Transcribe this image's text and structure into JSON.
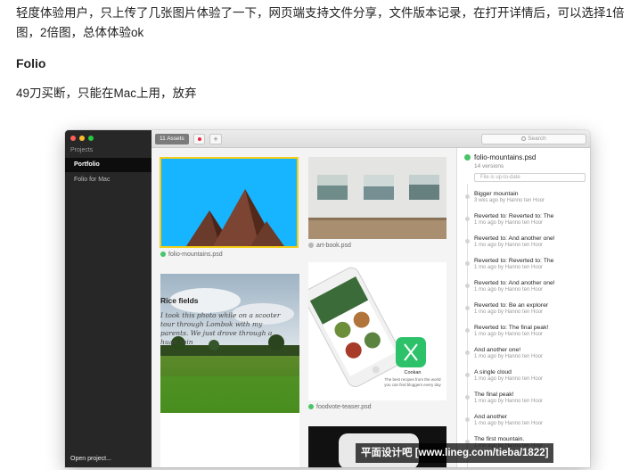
{
  "article": {
    "intro": "轻度体验用户，只上传了几张图片体验了一下，网页端支持文件分享，文件版本记录，在打开详情后，可以选择1倍图，2倍图，总体体验ok",
    "heading": "Folio",
    "verdict": "49刀买断，只能在Mac上用，放弃"
  },
  "app": {
    "sidebar": {
      "section_label": "Projects",
      "items": [
        {
          "label": "Portfolio",
          "selected": true
        },
        {
          "label": "Folio for Mac",
          "selected": false
        }
      ],
      "open_project_label": "Open project..."
    },
    "toolbar": {
      "assets_tab_label": "11 Assets",
      "add_label": "+",
      "search_placeholder": "Search"
    },
    "assets": [
      {
        "name": "folio-mountains.psd",
        "status": "green"
      },
      {
        "name": "art-book.psd",
        "status": "gray"
      },
      {
        "name": "foodvote-teaser.psd",
        "status": "green"
      }
    ],
    "rice_card": {
      "title": "Rice fields",
      "body": "I took this photo while on a scooter tour through Lombok with my parents. We just drove through a huge rain"
    },
    "versions": {
      "file_name": "folio-mountains.psd",
      "count_label": "14 versions",
      "status_text": "File is up-to-date",
      "entries": [
        {
          "title": "Bigger mountain",
          "meta": "3 wks ago by Hanno ten Hoor"
        },
        {
          "title": "Reverted to: Reverted to: The",
          "meta": "1 mo ago by Hanno ten Hoor"
        },
        {
          "title": "Reverted to: And another one!",
          "meta": "1 mo ago by Hanno ten Hoor"
        },
        {
          "title": "Reverted to: Reverted to: The",
          "meta": "1 mo ago by Hanno ten Hoor"
        },
        {
          "title": "Reverted to: And another one!",
          "meta": "1 mo ago by Hanno ten Hoor"
        },
        {
          "title": "Reverted to: Be an explorer",
          "meta": "1 mo ago by Hanno ten Hoor"
        },
        {
          "title": "Reverted to: The final peak!",
          "meta": "1 mo ago by Hanno ten Hoor"
        },
        {
          "title": "And another one!",
          "meta": "1 mo ago by Hanno ten Hoor"
        },
        {
          "title": "A single cloud",
          "meta": "1 mo ago by Hanno ten Hoor"
        },
        {
          "title": "The final peak!",
          "meta": "1 mo ago by Hanno ten Hoor"
        },
        {
          "title": "And another",
          "meta": "1 mo ago by Hanno ten Hoor"
        },
        {
          "title": "The first mountain.",
          "meta": "1 mo ago by Hanno ten Hoor"
        }
      ]
    },
    "foodvote_screen": {
      "app_name": "Cookan",
      "tagline": "The best recipes from the world you can find bloggers every day"
    }
  },
  "watermark": "平面设计吧 [www.lineg.com/tieba/1822]",
  "colors": {
    "selection_yellow": "#f5cf1a",
    "sky_blue": "#17b5ff",
    "status_green": "#49c469",
    "sidebar_dark": "#272727"
  }
}
